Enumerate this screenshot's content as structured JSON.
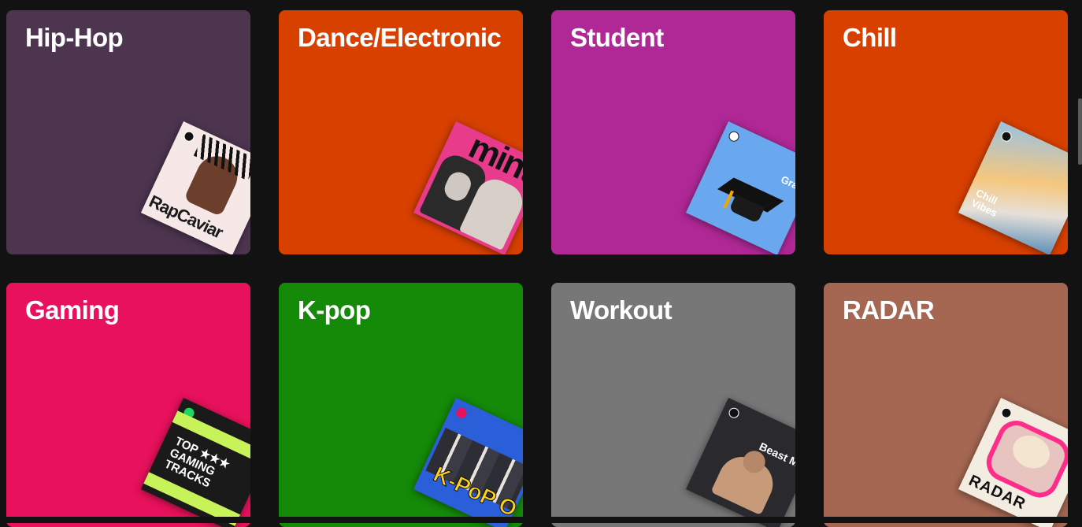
{
  "categories": [
    {
      "title": "Hip-Hop",
      "color": "#4d3550",
      "art_text": "RapCaviar",
      "art_bg": "#f6e8e6",
      "art_fg": "#1b1b1b"
    },
    {
      "title": "Dance/Electronic",
      "color": "#d84000",
      "art_text": "mint",
      "art_bg": "#e93b8b",
      "art_fg": "#111111"
    },
    {
      "title": "Student",
      "color": "#af2896",
      "art_text": "Grad",
      "art_bg": "#69a8ef",
      "art_fg": "#ffffff"
    },
    {
      "title": "Chill",
      "color": "#d84000",
      "art_text": "Chill Vibes",
      "art_bg": "#7fa7c8",
      "art_fg": "#ffffff"
    },
    {
      "title": "Gaming",
      "color": "#e8115b",
      "art_text": "TOP ★★★ GAMING TRACKS",
      "art_bg": "#1a1a1a",
      "art_fg": "#ffffff"
    },
    {
      "title": "K-pop",
      "color": "#148a08",
      "art_text": "K-PoP ON!",
      "art_bg": "#2b5fd9",
      "art_fg": "#ffd21a"
    },
    {
      "title": "Workout",
      "color": "#777777",
      "art_text": "Beast Mode",
      "art_bg": "#2a2a2e",
      "art_fg": "#ffffff"
    },
    {
      "title": "RADAR",
      "color": "#a56752",
      "art_text": "RADAR",
      "art_bg": "#f3ece0",
      "art_fg": "#111111"
    }
  ]
}
